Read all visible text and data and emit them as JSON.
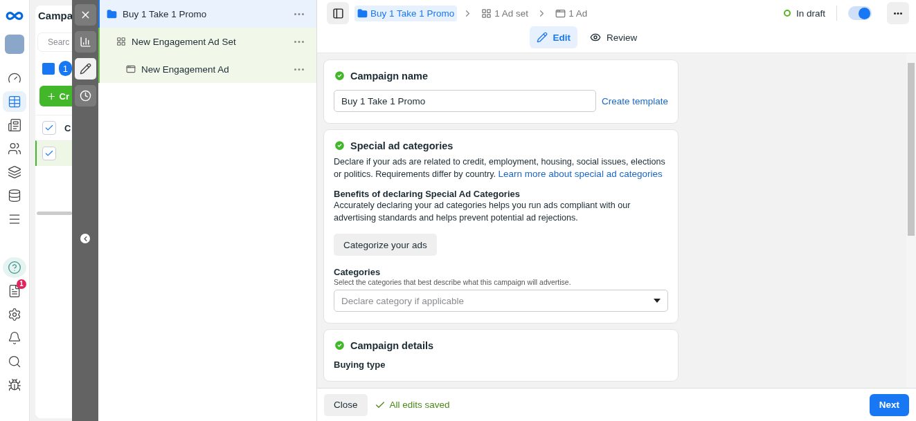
{
  "nav": {
    "items": [
      {
        "kind": "logo",
        "selected": false
      },
      {
        "kind": "avatar",
        "selected": false
      },
      {
        "kind": "dashboard",
        "selected": false
      },
      {
        "kind": "table",
        "selected": true
      },
      {
        "kind": "pages",
        "selected": false
      },
      {
        "kind": "people",
        "selected": false
      },
      {
        "kind": "catalog",
        "selected": false
      },
      {
        "kind": "database",
        "selected": false
      },
      {
        "kind": "menu",
        "selected": false
      },
      {
        "kind": "help",
        "selected": true
      },
      {
        "kind": "news",
        "selected": false,
        "badge": "1"
      },
      {
        "kind": "settings",
        "selected": false
      },
      {
        "kind": "bell",
        "selected": false
      },
      {
        "kind": "search",
        "selected": false
      },
      {
        "kind": "bug",
        "selected": false
      }
    ]
  },
  "manager": {
    "title": "Campa",
    "search": {
      "placeholder": "Searc"
    },
    "count": "1",
    "create_label": "Cr",
    "column_1": "C",
    "header_checked": true,
    "rows": [
      {
        "checked": true,
        "selected": true
      }
    ]
  },
  "rail": {
    "tools": [
      {
        "kind": "close",
        "selected": false
      },
      {
        "kind": "chart",
        "selected": false
      },
      {
        "kind": "edit",
        "selected": true
      },
      {
        "kind": "history",
        "selected": false
      }
    ]
  },
  "tree": [
    {
      "label": "Buy 1 Take 1 Promo",
      "kind": "campaign",
      "selected": true,
      "children": [
        {
          "label": "New Engagement Ad Set",
          "kind": "adset",
          "selected": false,
          "children": [
            {
              "label": "New Engagement Ad",
              "kind": "ad",
              "selected": false
            }
          ]
        }
      ]
    }
  ],
  "breadcrumb": [
    {
      "label": "Buy 1 Take 1 Promo",
      "kind": "campaign",
      "selected": true
    },
    {
      "label": "1 Ad set",
      "kind": "adset",
      "selected": false
    },
    {
      "label": "1 Ad",
      "kind": "ad",
      "selected": false
    }
  ],
  "status": {
    "label": "In draft",
    "on": true
  },
  "mode_tabs": [
    {
      "label": "Edit",
      "kind": "edit",
      "selected": true
    },
    {
      "label": "Review",
      "kind": "review",
      "selected": false
    }
  ],
  "campaign_name": {
    "title": "Campaign name",
    "value": "Buy 1 Take 1 Promo",
    "link": "Create template"
  },
  "special_ad_categories": {
    "title": "Special ad categories",
    "description": "Declare if your ads are related to credit, employment, housing, social issues, elections or politics. Requirements differ by country.",
    "link": "Learn more about special ad categories",
    "benefits_title": "Benefits of declaring Special Ad Categories",
    "benefits_text": "Accurately declaring your ad categories helps you run ads compliant with our advertising standards and helps prevent potential ad rejections.",
    "button": "Categorize your ads",
    "categories_label": "Categories",
    "categories_hint": "Select the categories that best describe what this campaign will advertise.",
    "select": {
      "placeholder": "Declare category if applicable"
    }
  },
  "campaign_details": {
    "title": "Campaign details",
    "buying_type_label": "Buying type"
  },
  "footer": {
    "close": "Close",
    "saved": "All edits saved",
    "next": "Next"
  }
}
